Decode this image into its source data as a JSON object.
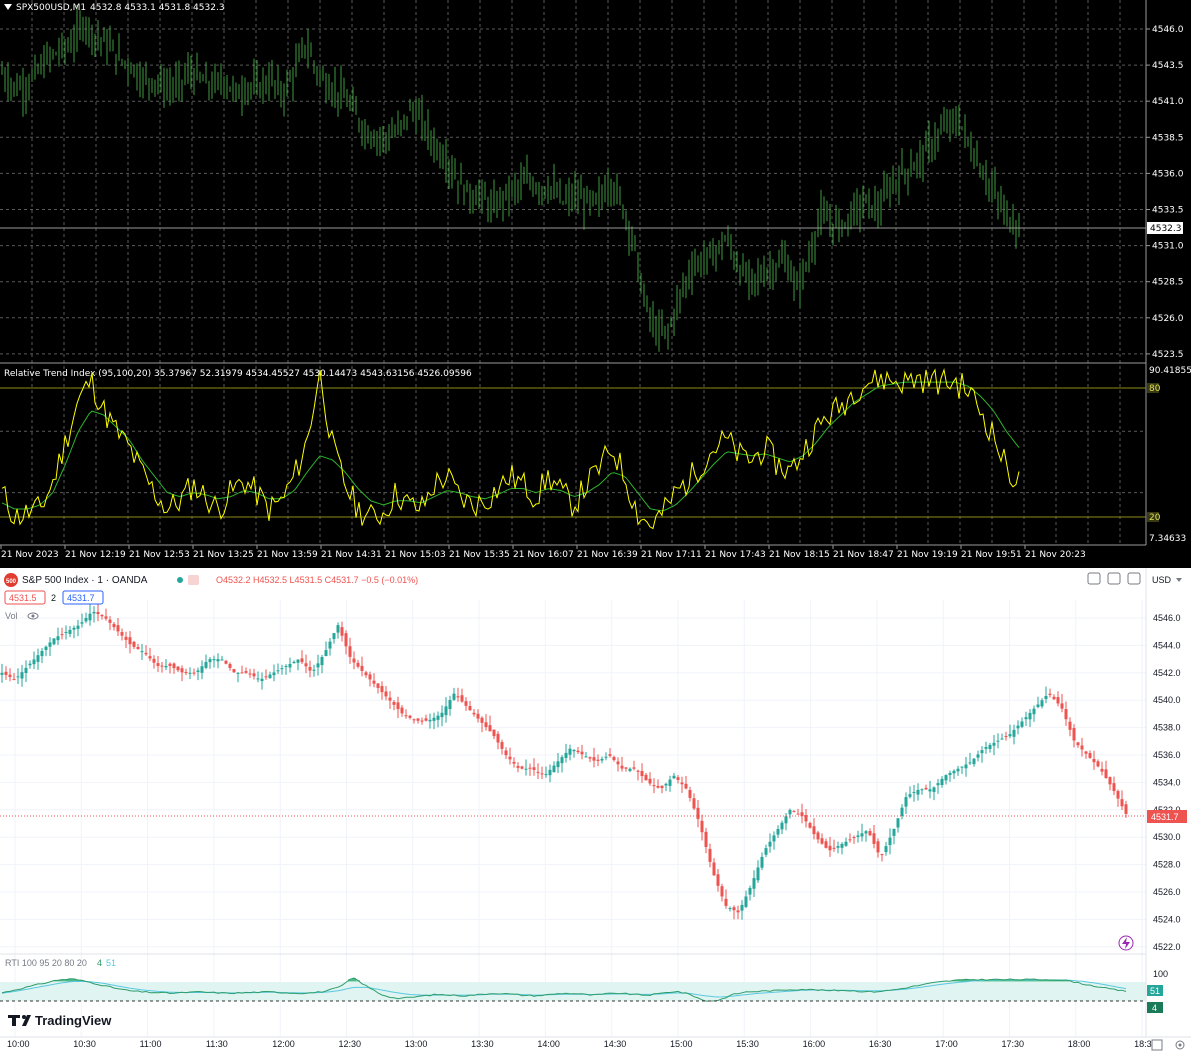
{
  "colors": {
    "mt_bg": "#000000",
    "mt_grid": "#5a5a5a",
    "mt_bar": "#3f9a3f",
    "mt_rti_main": "#ffff00",
    "mt_rti_signal": "#2db52d",
    "mt_level": "#8b8b1a",
    "tv_bg": "#ffffff",
    "tv_up": "#26a69a",
    "tv_down": "#ef5350",
    "tv_rti_main": "#2d9d6a",
    "tv_rti_signal": "#5ac8e0"
  },
  "mt_header": {
    "symbol": "SPX500USD,M1",
    "ohlc": "4532.8 4533.1 4531.8 4532.3",
    "arrow_icon": "triangle-down"
  },
  "mt_price_axis": {
    "labels": [
      "4546.0",
      "4543.5",
      "4541.0",
      "4538.5",
      "4536.0",
      "4533.5",
      "4531.0",
      "4528.5",
      "4526.0",
      "4523.5"
    ],
    "current_label": "4532.3"
  },
  "mt_rti": {
    "header": "Relative Trend Index (95,100,20) 35.37967 52.31979 4534.45527 4530.14473 4543.63156 4526.09596",
    "axis_max": "90.41855",
    "axis_min": "7.34633",
    "level_high": "80",
    "level_low": "20"
  },
  "mt_time_axis": [
    "21 Nov 2023",
    "21 Nov 12:19",
    "21 Nov 12:53",
    "21 Nov 13:25",
    "21 Nov 13:59",
    "21 Nov 14:31",
    "21 Nov 15:03",
    "21 Nov 15:35",
    "21 Nov 16:07",
    "21 Nov 16:39",
    "21 Nov 17:11",
    "21 Nov 17:43",
    "21 Nov 18:15",
    "21 Nov 18:47",
    "21 Nov 19:19",
    "21 Nov 19:51",
    "21 Nov 20:23"
  ],
  "tv_header": {
    "logo_text": "500",
    "title": "S&P 500 Index · 1 · OANDA",
    "ohlc": "O4532.2 H4532.5 L4531.5 C4531.7 −0.5 (−0.01%)",
    "bid": "4531.5",
    "spread": "2",
    "ask": "4531.7",
    "vol_label": "Vol",
    "currency": "USD"
  },
  "tv_price_axis": {
    "labels": [
      "4546.0",
      "4544.0",
      "4542.0",
      "4540.0",
      "4538.0",
      "4536.0",
      "4534.0",
      "4532.0",
      "4530.0",
      "4528.0",
      "4526.0",
      "4524.0",
      "4522.0"
    ],
    "current_label": "4531.7"
  },
  "tv_rti": {
    "header": "RTI 100 95 20 80 20",
    "value_1": "4",
    "value_2": "51",
    "axis_100": "100",
    "badge_signal": "51",
    "badge_main": "4"
  },
  "tv_time_axis": [
    "10:00",
    "10:30",
    "11:00",
    "11:30",
    "12:00",
    "12:30",
    "13:00",
    "13:30",
    "14:00",
    "14:30",
    "15:00",
    "15:30",
    "16:00",
    "16:30",
    "17:00",
    "17:30",
    "18:00",
    "18:3"
  ],
  "tv_brand": "TradingView",
  "chart_data": [
    {
      "type": "candlestick",
      "title": "SPX500USD,M1",
      "ylim": [
        4523.5,
        4546.0
      ],
      "x_labels": [
        "21 Nov 2023",
        "21 Nov 12:19",
        "21 Nov 12:53",
        "21 Nov 13:25",
        "21 Nov 13:59",
        "21 Nov 14:31",
        "21 Nov 15:03",
        "21 Nov 15:35",
        "21 Nov 16:07",
        "21 Nov 16:39",
        "21 Nov 17:11",
        "21 Nov 17:43",
        "21 Nov 18:15",
        "21 Nov 18:47",
        "21 Nov 19:19",
        "21 Nov 19:51",
        "21 Nov 20:23"
      ],
      "close_path": [
        4543.0,
        4542.0,
        4542.0,
        4543.0,
        4544.0,
        4544.5,
        4545.0,
        4546.5,
        4545.5,
        4545.0,
        4544.0,
        4543.5,
        4542.5,
        4542.5,
        4542.0,
        4542.0,
        4543.0,
        4542.5,
        4542.0,
        4542.5,
        4541.5,
        4542.0,
        4542.0,
        4542.5,
        4541.5,
        4543.0,
        4545.0,
        4543.0,
        4542.0,
        4541.5,
        4540.5,
        4539.0,
        4538.5,
        4538.5,
        4539.0,
        4540.5,
        4539.5,
        4538.0,
        4537.0,
        4535.5,
        4534.5,
        4534.5,
        4533.5,
        4534.5,
        4535.0,
        4535.5,
        4535.0,
        4535.0,
        4534.0,
        4534.5,
        4534.0,
        4534.0,
        4535.5,
        4534.0,
        4531.5,
        4527.0,
        4525.0,
        4525.0,
        4527.5,
        4529.5,
        4530.0,
        4530.5,
        4531.5,
        4529.5,
        4528.5,
        4529.0,
        4529.5,
        4530.0,
        4528.0,
        4530.0,
        4533.0,
        4532.5,
        4532.5,
        4533.5,
        4534.0,
        4533.5,
        4535.0,
        4536.0,
        4536.5,
        4537.5,
        4538.5,
        4539.5,
        4539.5,
        4537.5,
        4536.0,
        4534.5,
        4533.0,
        4532.3
      ],
      "current": 4532.3
    },
    {
      "type": "line",
      "title": "Relative Trend Index (95,100,20)",
      "ylim": [
        7.34633,
        90.41855
      ],
      "levels": [
        80,
        20
      ],
      "series": [
        {
          "name": "",
          "values": [
            30,
            18,
            20,
            22,
            35,
            55,
            75,
            85,
            70,
            60,
            52,
            40,
            30,
            22,
            26,
            34,
            28,
            22,
            30,
            36,
            30,
            22,
            26,
            38,
            55,
            90,
            52,
            34,
            22,
            18,
            20,
            30,
            24,
            22,
            34,
            38,
            28,
            24,
            26,
            32,
            38,
            34,
            28,
            38,
            30,
            24,
            34,
            42,
            52,
            38,
            20,
            14,
            20,
            30,
            36,
            44,
            52,
            56,
            48,
            46,
            52,
            44,
            40,
            50,
            60,
            68,
            72,
            80,
            84,
            86,
            85,
            84,
            86,
            85,
            84,
            84,
            80,
            70,
            58,
            42,
            35
          ]
        },
        {
          "name": "",
          "values": [
            25,
            22,
            22,
            24,
            30,
            44,
            60,
            70,
            68,
            62,
            56,
            46,
            38,
            30,
            28,
            30,
            29,
            27,
            28,
            31,
            30,
            27,
            27,
            31,
            40,
            48,
            46,
            40,
            32,
            26,
            24,
            26,
            26,
            25,
            28,
            31,
            30,
            28,
            27,
            29,
            32,
            32,
            30,
            32,
            31,
            28,
            30,
            34,
            40,
            38,
            30,
            22,
            21,
            24,
            30,
            37,
            44,
            50,
            49,
            48,
            49,
            47,
            45,
            48,
            54,
            62,
            68,
            74,
            78,
            82,
            83,
            84,
            84,
            84,
            84,
            84,
            82,
            77,
            70,
            60,
            52
          ]
        }
      ]
    },
    {
      "type": "candlestick",
      "title": "S&P 500 Index · 1 · OANDA",
      "ylim": [
        4522.0,
        4546.0
      ],
      "x_labels": [
        "10:00",
        "10:30",
        "11:00",
        "11:30",
        "12:00",
        "12:30",
        "13:00",
        "13:30",
        "14:00",
        "14:30",
        "15:00",
        "15:30",
        "16:00",
        "16:30",
        "17:00",
        "17:30",
        "18:00",
        "18:3"
      ],
      "close_path": [
        4542.0,
        4541.5,
        4542.5,
        4543.5,
        4544.5,
        4545.0,
        4545.5,
        4546.5,
        4546.0,
        4545.0,
        4544.0,
        4543.5,
        4542.5,
        4542.5,
        4542.0,
        4542.0,
        4543.0,
        4543.0,
        4542.0,
        4542.0,
        4541.5,
        4542.0,
        4542.5,
        4543.0,
        4542.0,
        4543.5,
        4545.5,
        4543.0,
        4542.0,
        4541.0,
        4540.0,
        4539.0,
        4538.5,
        4538.5,
        4539.0,
        4540.5,
        4539.5,
        4538.5,
        4537.5,
        4536.0,
        4535.0,
        4535.0,
        4534.5,
        4535.5,
        4536.5,
        4536.0,
        4535.5,
        4536.0,
        4535.0,
        4535.0,
        4534.0,
        4533.5,
        4534.5,
        4533.5,
        4531.0,
        4527.5,
        4525.0,
        4524.5,
        4526.5,
        4529.0,
        4530.5,
        4532.0,
        4531.5,
        4530.0,
        4529.0,
        4529.5,
        4530.0,
        4530.5,
        4528.5,
        4530.5,
        4533.0,
        4533.5,
        4533.5,
        4534.5,
        4535.0,
        4535.5,
        4536.5,
        4537.0,
        4537.5,
        4538.5,
        4539.5,
        4540.5,
        4539.5,
        4537.0,
        4536.0,
        4535.0,
        4533.5,
        4531.7
      ],
      "current": 4531.7
    },
    {
      "type": "line",
      "title": "RTI 100 95 20 80 20",
      "series": [
        {
          "name": "",
          "values": [
            45,
            55,
            65,
            75,
            85,
            88,
            80,
            70,
            60,
            52,
            48,
            46,
            44,
            46,
            48,
            46,
            44,
            45,
            47,
            48,
            46,
            44,
            45,
            50,
            62,
            92,
            64,
            40,
            28,
            30,
            36,
            40,
            38,
            36,
            40,
            44,
            42,
            38,
            36,
            40,
            44,
            42,
            38,
            42,
            44,
            40,
            38,
            44,
            50,
            40,
            20,
            22,
            40,
            48,
            50,
            52,
            55,
            56,
            54,
            52,
            53,
            50,
            48,
            52,
            58,
            66,
            74,
            80,
            84,
            86,
            86,
            86,
            86,
            86,
            86,
            86,
            82,
            72,
            64,
            56,
            50
          ]
        },
        {
          "name": "",
          "values": [
            44,
            50,
            58,
            66,
            74,
            80,
            80,
            76,
            68,
            60,
            54,
            50,
            47,
            46,
            46,
            46,
            45,
            45,
            46,
            47,
            46,
            45,
            45,
            47,
            52,
            62,
            62,
            54,
            46,
            40,
            38,
            38,
            38,
            38,
            39,
            41,
            41,
            40,
            38,
            39,
            41,
            41,
            40,
            41,
            42,
            41,
            40,
            42,
            45,
            43,
            36,
            32,
            35,
            40,
            44,
            47,
            50,
            53,
            54,
            53,
            53,
            52,
            51,
            52,
            55,
            60,
            66,
            72,
            77,
            81,
            84,
            85,
            85,
            85,
            85,
            85,
            84,
            80,
            74,
            66,
            58
          ]
        }
      ]
    }
  ]
}
